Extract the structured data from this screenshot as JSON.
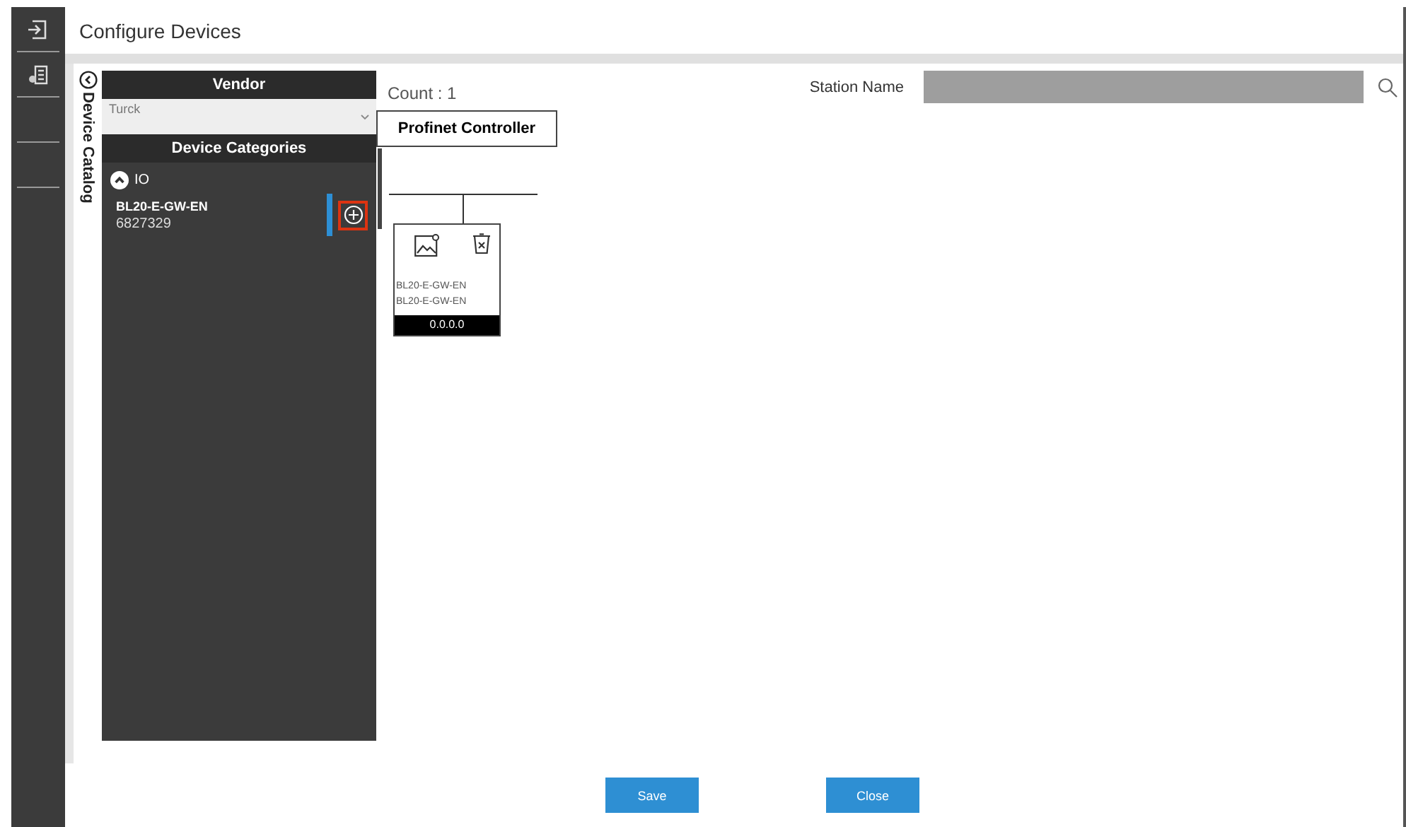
{
  "window": {
    "title": "Configure Devices"
  },
  "catalog": {
    "title": "Device Catalog",
    "vendor_heading": "Vendor",
    "vendor": "Turck",
    "categories_heading": "Device Categories",
    "categories": [
      {
        "label": "IO",
        "expanded": true,
        "children": [
          {
            "name": "BL20-E-GW-EN",
            "number": "6827329",
            "selected": true
          }
        ]
      }
    ]
  },
  "count": "Count : 1",
  "station_name": {
    "label": "Station Name"
  },
  "controller": "Profinet Controller",
  "devices": [
    {
      "name": "BL20-E-GW-EN",
      "type": "BL20-E-GW-EN",
      "ip": "0.0.0.0"
    }
  ],
  "buttons": [
    "Save",
    "Close"
  ]
}
